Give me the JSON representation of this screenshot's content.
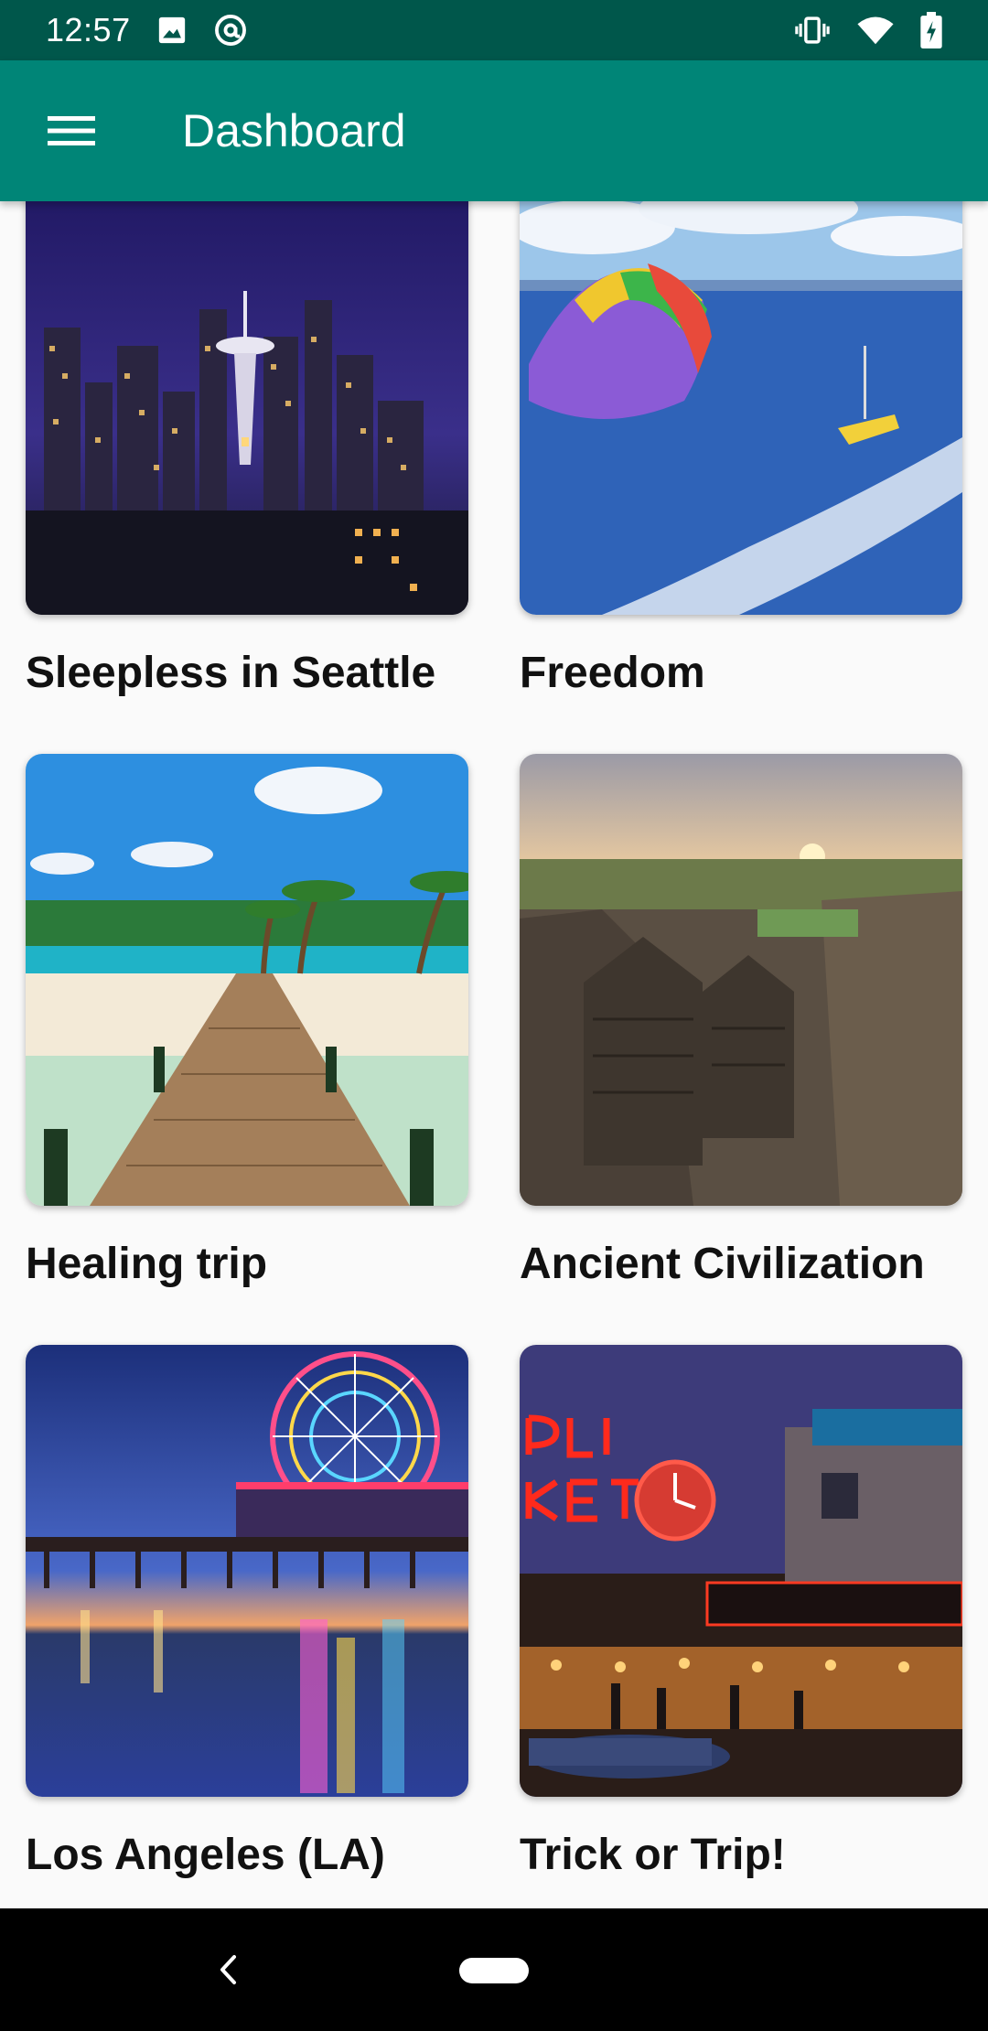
{
  "status_bar": {
    "time": "12:57",
    "left_icons": [
      "image-icon",
      "at-sign-icon"
    ],
    "right_icons": [
      "vibrate-icon",
      "wifi-icon",
      "battery-charging-icon"
    ]
  },
  "app_bar": {
    "title": "Dashboard",
    "menu_icon": "hamburger-menu-icon",
    "background_color": "#008577",
    "status_color": "#00574b"
  },
  "cards": [
    {
      "title": "Sleepless in Seattle",
      "image": "seattle-night-skyline"
    },
    {
      "title": "Freedom",
      "image": "parasailing-ocean"
    },
    {
      "title": "Healing trip",
      "image": "tropical-pier-beach"
    },
    {
      "title": "Ancient Civilization",
      "image": "ancient-rock-temple"
    },
    {
      "title": "Los Angeles (LA)",
      "image": "santa-monica-pier-ferris-wheel"
    },
    {
      "title": "Trick or Trip!",
      "image": "public-market-center"
    }
  ],
  "nav_bar": {
    "back_icon": "back-chevron-icon",
    "home_icon": "home-pill-icon"
  }
}
